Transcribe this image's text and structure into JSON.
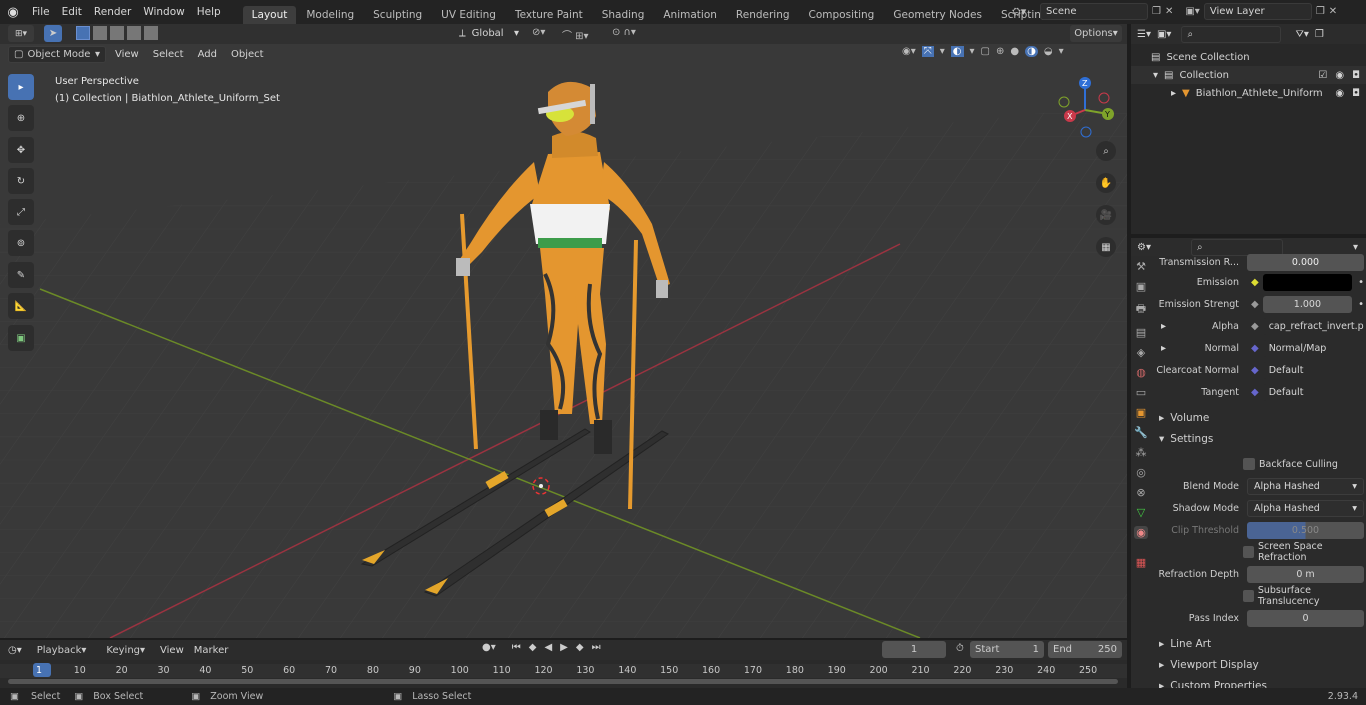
{
  "menu": [
    "File",
    "Edit",
    "Render",
    "Window",
    "Help"
  ],
  "workspaces": [
    "Layout",
    "Modeling",
    "Sculpting",
    "UV Editing",
    "Texture Paint",
    "Shading",
    "Animation",
    "Rendering",
    "Compositing",
    "Geometry Nodes",
    "Scripting"
  ],
  "active_workspace": "Layout",
  "scene": {
    "name": "Scene",
    "view_layer": "View Layer"
  },
  "header3d": {
    "mode": "Object Mode",
    "view": "View",
    "select": "Select",
    "add": "Add",
    "object": "Object",
    "orientation": "Global",
    "options": "Options"
  },
  "viewport": {
    "perspective": "User Perspective",
    "collection_info": "(1) Collection | Biathlon_Athlete_Uniform_Set"
  },
  "gizmo": {
    "z": "Z",
    "y": "Y",
    "x": "X"
  },
  "outliner": {
    "scene_collection": "Scene Collection",
    "collection": "Collection",
    "object": "Biathlon_Athlete_Uniform"
  },
  "props": {
    "transmission_label": "Transmission R...",
    "transmission_value": "0.000",
    "emission_label": "Emission",
    "emission_color": "#000000",
    "emission_strength_label": "Emission Strengt",
    "emission_strength_value": "1.000",
    "alpha_label": "Alpha",
    "alpha_value": "cap_refract_invert.pn",
    "normal_label": "Normal",
    "normal_value": "Normal/Map",
    "clearcoat_label": "Clearcoat Normal",
    "clearcoat_value": "Default",
    "tangent_label": "Tangent",
    "tangent_value": "Default",
    "volume": "Volume",
    "settings": "Settings",
    "backface": "Backface Culling",
    "blend_label": "Blend Mode",
    "blend_value": "Alpha Hashed",
    "shadow_label": "Shadow Mode",
    "shadow_value": "Alpha Hashed",
    "clip_label": "Clip Threshold",
    "clip_value": "0.500",
    "ssr": "Screen Space Refraction",
    "refr_label": "Refraction Depth",
    "refr_value": "0 m",
    "sst": "Subsurface Translucency",
    "pass_label": "Pass Index",
    "pass_value": "0",
    "line_art": "Line Art",
    "viewport_display": "Viewport Display",
    "custom_props": "Custom Properties"
  },
  "timeline": {
    "playback": "Playback",
    "keying": "Keying",
    "view": "View",
    "marker": "Marker",
    "current_frame": "1",
    "start_label": "Start",
    "start": "1",
    "end_label": "End",
    "end": "250",
    "ticks": [
      "1",
      "10",
      "20",
      "30",
      "40",
      "50",
      "60",
      "70",
      "80",
      "90",
      "100",
      "110",
      "120",
      "130",
      "140",
      "150",
      "160",
      "170",
      "180",
      "190",
      "200",
      "210",
      "220",
      "230",
      "240",
      "250"
    ]
  },
  "status": {
    "select": "Select",
    "box_select": "Box Select",
    "zoom_view": "Zoom View",
    "lasso_select": "Lasso Select",
    "version": "2.93.4"
  },
  "colors": {
    "accent": "#4772b3",
    "x_axis": "#c9394a",
    "y_axis": "#7fa32a",
    "z_axis": "#2f6fd6",
    "suit_orange": "#e49630"
  }
}
